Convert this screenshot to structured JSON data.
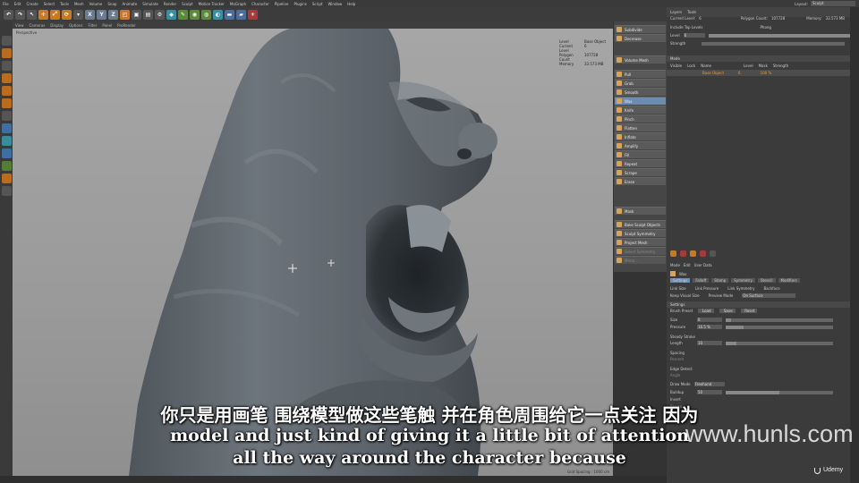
{
  "menu": [
    "File",
    "Edit",
    "Create",
    "Select",
    "Tools",
    "Mesh",
    "Volume",
    "Snap",
    "Animate",
    "Simulate",
    "Render",
    "Sculpt",
    "Motion Tracker",
    "MoGraph",
    "Character",
    "Pipeline",
    "Plugins",
    "Script",
    "Window",
    "Help"
  ],
  "layout": {
    "label": "Layout:",
    "value": "Sculpt"
  },
  "toolbar": {
    "x": "X",
    "y": "Y",
    "z": "Z"
  },
  "viewport_menu": [
    "View",
    "Cameras",
    "Display",
    "Options",
    "Filter",
    "Panel",
    "ProRender"
  ],
  "viewport": {
    "label": "Perspective",
    "hud": [
      {
        "k": "Level",
        "v": "Base Object"
      },
      {
        "k": "Current Level",
        "v": "6"
      },
      {
        "k": "Polygon Count",
        "v": "107728"
      },
      {
        "k": "Memory",
        "v": "33.573 MB"
      }
    ],
    "grid_spacing": "Grid Spacing : 1000 cm"
  },
  "brushes": {
    "top": [
      {
        "label": "Subdivide"
      },
      {
        "label": "Decrease"
      },
      {
        "label": "Volume Mesh"
      }
    ],
    "items": [
      {
        "label": "Pull"
      },
      {
        "label": "Grab"
      },
      {
        "label": "Smooth"
      },
      {
        "label": "Wax",
        "active": true
      },
      {
        "label": "Knife"
      },
      {
        "label": "Pinch"
      },
      {
        "label": "Flatten"
      },
      {
        "label": "Inflate"
      },
      {
        "label": "Amplify"
      },
      {
        "label": "Fill"
      },
      {
        "label": "Repeat"
      },
      {
        "label": "Scrape"
      },
      {
        "label": "Erase"
      }
    ],
    "mask_item": "Mask",
    "bake": [
      {
        "label": "Bake Sculpt Objects"
      },
      {
        "label": "Sculpt Symmetry"
      },
      {
        "label": "Project Mesh"
      },
      {
        "label": "Select Symmetry"
      },
      {
        "label": "Mirror..."
      }
    ]
  },
  "layers": {
    "tabs": [
      "Layers",
      "Tools"
    ],
    "current_level_label": "Current Level:",
    "current_level": "6",
    "polygon_count_label": "Polygon Count:",
    "polygon_count": "107728",
    "memory_label": "Memory:",
    "memory": "33.573 MB",
    "include_top": "Include Top Levels",
    "phong": "Phong",
    "level_label": "Level",
    "strength_label": "Strength",
    "mode_label": "Mode",
    "cols": [
      "Visible",
      "Lock",
      "Name",
      "Level",
      "Mask",
      "Strength"
    ],
    "row": {
      "name": "Base Object",
      "level": "6",
      "strength": "100 %"
    }
  },
  "attributes": {
    "menu": [
      "Mode",
      "Edit",
      "User Data"
    ],
    "title": "Wax",
    "tabs": [
      "Settings",
      "Falloff",
      "Stamp",
      "Symmetry",
      "Stencil",
      "Modifiers"
    ],
    "link_size": "Link Size",
    "link_pressure": "Link Pressure",
    "link_symmetry": "Link Symmetry",
    "backface": "Backface",
    "keep_visual_size": "Keep Visual Size",
    "preview_mode": "Preview Mode",
    "preview_value": "On Surface",
    "section_settings": "Settings",
    "brush_preset": "Brush Preset",
    "load": "Load",
    "save": "Save",
    "reset": "Reset",
    "size_label": "Size",
    "size_value": "8",
    "pressure_label": "Pressure",
    "pressure_value": "16.5 %",
    "steady_label": "Steady Stroke",
    "length_label": "Length",
    "length_value": "10",
    "spacing_label": "Spacing",
    "percent_label": "Percent",
    "edge_label": "Edge Detect",
    "angle_label": "Angle",
    "draw_mode_label": "Draw Mode",
    "draw_mode_value": "Freehand",
    "buildup_label": "Buildup",
    "buildup_value": "50",
    "invert_label": "Invert",
    "stamp_label": "Stamp"
  },
  "subtitles": {
    "cn": "你只是用画笔 围绕模型做这些笔触 并在角色周围给它一点关注 因为",
    "en1": "model and just kind of giving it a little bit of attention",
    "en2": "all the way around the character because"
  },
  "watermark": "www.hunls.com",
  "udemy": "Udemy",
  "colors": {
    "accent": "#6d8db0",
    "viewport": "#a0a0a0",
    "panel": "#3b3b3b"
  }
}
